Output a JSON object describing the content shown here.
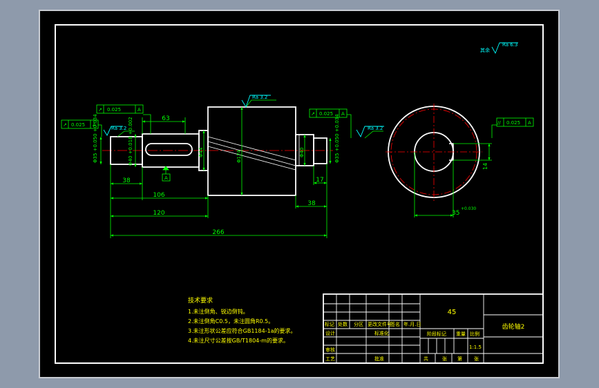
{
  "colors": {
    "backdrop": "#8e9aab",
    "paper": "#000000",
    "outline": "#ffffff",
    "dimension": "#00ff00",
    "centerline": "#ff0000",
    "symbol": "#00ffff",
    "text": "#ffff00"
  },
  "roughness": {
    "rest": "Ra 6.3",
    "rest_prefix": "其余",
    "journal_left": "Ra 3.2",
    "gear": "Ra 3.2",
    "journal_right": "Ra 3.2"
  },
  "tolerances": {
    "runout_left_upper": {
      "symbol": "↗",
      "value": "0.025",
      "datum": "A"
    },
    "runout_left_lower": {
      "symbol": "↗",
      "value": "0.025",
      "datum": "A"
    },
    "runout_right": {
      "symbol": "↗",
      "value": "0.025",
      "datum": "A"
    },
    "parallel_side": {
      "symbol": "//",
      "value": "0.025",
      "datum": "A"
    },
    "datum_label": "A"
  },
  "dims": {
    "key_length": "63",
    "shoulder_left": "38",
    "len_106": "106",
    "len_120": "120",
    "total": "266",
    "shoulder_right": "17",
    "len_38": "38",
    "dia_35_left": "Φ35 +0.050 +0.034",
    "dia_40": "Φ40 +0.018 +0.002",
    "dia_44": "Φ44",
    "dia_gear": "Φ174",
    "dia_40_right": "Φ40",
    "dia_35_right": "Φ35 +0.050 +0.034",
    "key_width": "14",
    "bore_depth": "35",
    "bore_tol": "+0.030"
  },
  "notes": {
    "heading": "技术要求",
    "items": [
      "1.未注倒角、锐边倒钝。",
      "2.未注倒角C0.5，未注圆角R0.5。",
      "3.未注形状公差应符合GB1184-1a的要求。",
      "4.未注尺寸公差按GB/T1804-m的要求。"
    ]
  },
  "title_block": {
    "material": "45",
    "drawing_name": "齿轮轴2",
    "headers": [
      "标记",
      "处数",
      "分区",
      "更改文件号",
      "签名",
      "年.月.日"
    ],
    "design": "设计",
    "standardize": "标准化",
    "review": "审核",
    "process": "工艺",
    "approve": "批准",
    "stage_mark": "阶段标记",
    "weight": "重量",
    "scale": "比例",
    "scale_value": "1:1.5",
    "sheets": [
      "共",
      "张",
      "第",
      "张"
    ]
  }
}
